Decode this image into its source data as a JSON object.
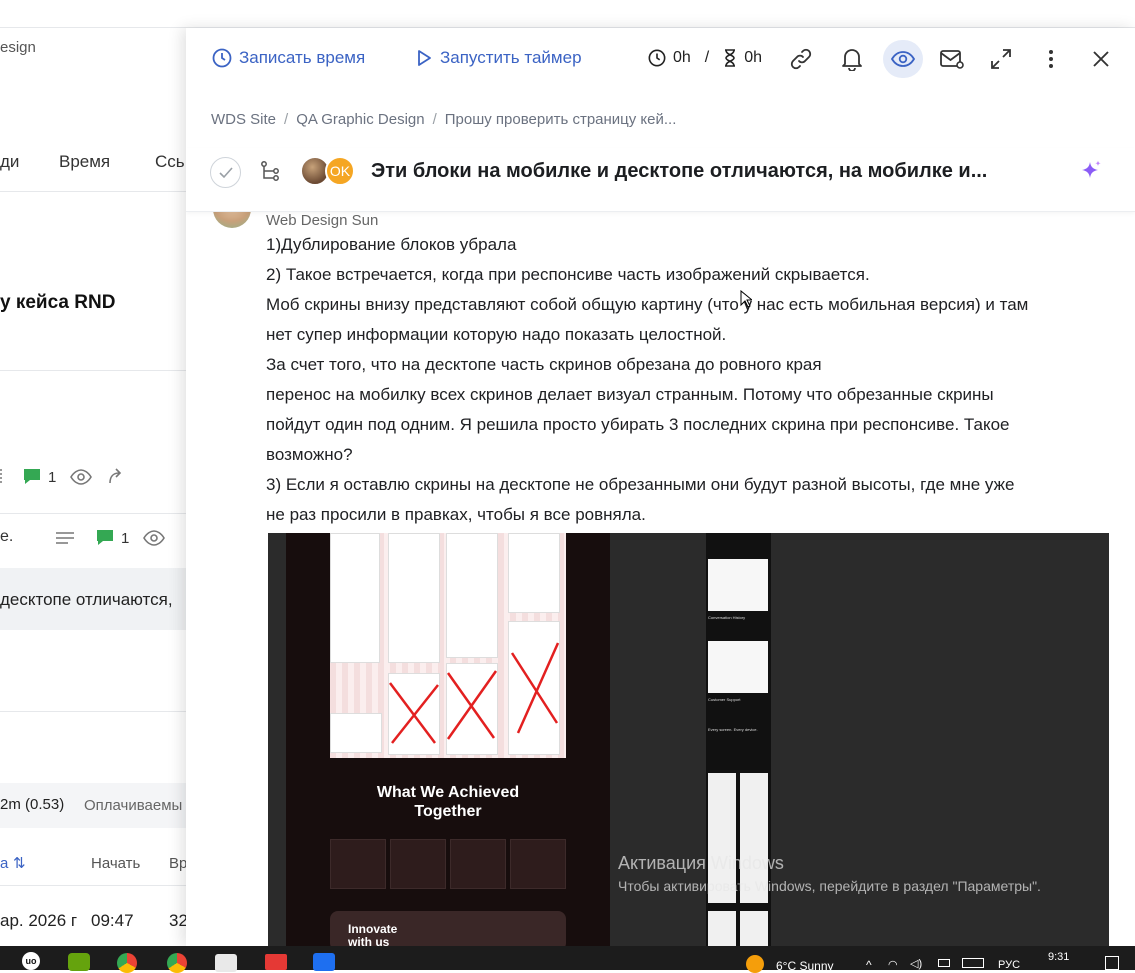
{
  "background": {
    "truncated_project": "esign",
    "tabs": [
      "ди",
      "Время",
      "Ссь"
    ],
    "heading": "у кейса RND",
    "row1_comments": "1",
    "row2_prefix": "е.",
    "row2_comments": "1",
    "highlight_text": "десктопе отличаются,",
    "time_summary": "2m (0.53)",
    "billable": "Оплачиваемы",
    "col_sort": "а",
    "col_start": "Начать",
    "col_time": "Вр",
    "row_date": "ар. 2026 г",
    "row_start": "09:47",
    "row_time": "32"
  },
  "toolbar": {
    "record_time": "Записать время",
    "start_timer": "Запустить таймер",
    "time_spent": "0h",
    "separator": "/",
    "time_estimate": "0h"
  },
  "breadcrumbs": [
    "WDS Site",
    "QA Graphic Design",
    "Прошу проверить страницу кей..."
  ],
  "task": {
    "avatar_initials": "OK",
    "title": "Эти блоки на мобилке и десктопе отличаются, на мобилке и..."
  },
  "comment": {
    "author": "Web Design Sun",
    "lines": [
      "1)Дублирование блоков убрала",
      "2) Такое встречается, когда при респонсиве часть изображений скрывается.",
      "Моб скрины внизу представляют собой общую картину (что у нас есть мобильная версия) и там",
      "нет супер информации которую надо показать целостной.",
      "За счет того, что на десктопе часть скринов обрезана до ровного края",
      "перенос на мобилку всех скринов делает визуал странным. Потому что обрезанные скрины",
      "пойдут один под одним. Я решила просто убирать 3 последних скрина при респонсиве. Такое",
      "возможно?",
      "3) Если я оставлю скрины на десктопе не обрезанными они будут разной высоты, где мне уже",
      "не раз просили в правках, чтобы я все ровняла."
    ],
    "image": {
      "heading_line1": "What We Achieved",
      "heading_line2": "Together",
      "bottom_line1": "Innovate",
      "bottom_line2": "with us",
      "mobile_caption1": "Conversation History",
      "mobile_caption2": "Customer Support",
      "mobile_caption3": "Every screen. Every device."
    }
  },
  "watermark": {
    "title": "Активация Windows",
    "subtitle": "Чтобы активировать Windows, перейдите в раздел \"Параметры\"."
  },
  "taskbar": {
    "weather": "6°C  Sunny",
    "language": "РУС",
    "time": "9:31"
  },
  "colors": {
    "accent": "#3b63c4",
    "green_comment": "#34a853",
    "avatar_orange": "#f5a623",
    "sparkle": "#8b5cf6",
    "strike_red": "#e32020"
  }
}
